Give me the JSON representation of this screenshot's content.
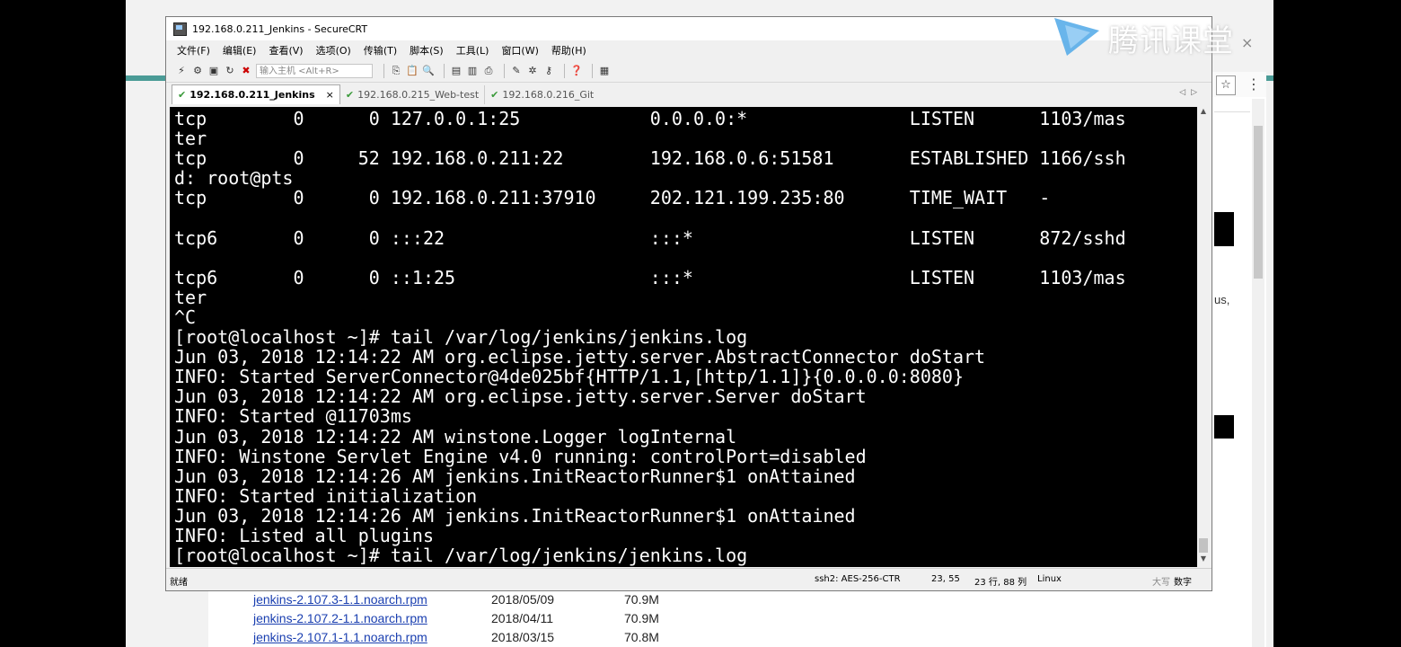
{
  "window": {
    "title": "192.168.0.211_Jenkins - SecureCRT"
  },
  "menu": [
    "文件(F)",
    "编辑(E)",
    "查看(V)",
    "选项(O)",
    "传输(T)",
    "脚本(S)",
    "工具(L)",
    "窗口(W)",
    "帮助(H)"
  ],
  "toolbar": {
    "host_placeholder": "输入主机 <Alt+R>"
  },
  "tabs": [
    {
      "label": "192.168.0.211_Jenkins",
      "active": true
    },
    {
      "label": "192.168.0.215_Web-test",
      "active": false
    },
    {
      "label": "192.168.0.216_Git",
      "active": false
    }
  ],
  "terminal": {
    "lines": [
      "tcp        0      0 127.0.0.1:25            0.0.0.0:*               LISTEN      1103/mas",
      "ter",
      "tcp        0     52 192.168.0.211:22        192.168.0.6:51581       ESTABLISHED 1166/ssh",
      "d: root@pts",
      "tcp        0      0 192.168.0.211:37910     202.121.199.235:80      TIME_WAIT   -",
      "",
      "tcp6       0      0 :::22                   :::*                    LISTEN      872/sshd",
      "",
      "tcp6       0      0 ::1:25                  :::*                    LISTEN      1103/mas",
      "ter",
      "^C",
      "[root@localhost ~]# tail /var/log/jenkins/jenkins.log",
      "Jun 03, 2018 12:14:22 AM org.eclipse.jetty.server.AbstractConnector doStart",
      "INFO: Started ServerConnector@4de025bf{HTTP/1.1,[http/1.1]}{0.0.0.0:8080}",
      "Jun 03, 2018 12:14:22 AM org.eclipse.jetty.server.Server doStart",
      "INFO: Started @11703ms",
      "Jun 03, 2018 12:14:22 AM winstone.Logger logInternal",
      "INFO: Winstone Servlet Engine v4.0 running: controlPort=disabled",
      "Jun 03, 2018 12:14:26 AM jenkins.InitReactorRunner$1 onAttained",
      "INFO: Started initialization",
      "Jun 03, 2018 12:14:26 AM jenkins.InitReactorRunner$1 onAttained",
      "INFO: Listed all plugins",
      "[root@localhost ~]# tail /var/log/jenkins/jenkins.log"
    ]
  },
  "status": {
    "ready": "就绪",
    "cipher": "ssh2: AES-256-CTR",
    "cursor": "23,  55",
    "size": "23 行, 88 列",
    "os": "Linux",
    "caps": "大写",
    "num": "数字"
  },
  "watermark": {
    "text": "腾讯课堂"
  },
  "background": {
    "partial_text": "us,",
    "files": [
      {
        "name": "jenkins-2.107.3-1.1.noarch.rpm",
        "date": "2018/05/09",
        "size": "70.9M"
      },
      {
        "name": "jenkins-2.107.2-1.1.noarch.rpm",
        "date": "2018/04/11",
        "size": "70.9M"
      },
      {
        "name": "jenkins-2.107.1-1.1.noarch.rpm",
        "date": "2018/03/15",
        "size": "70.8M"
      }
    ]
  }
}
